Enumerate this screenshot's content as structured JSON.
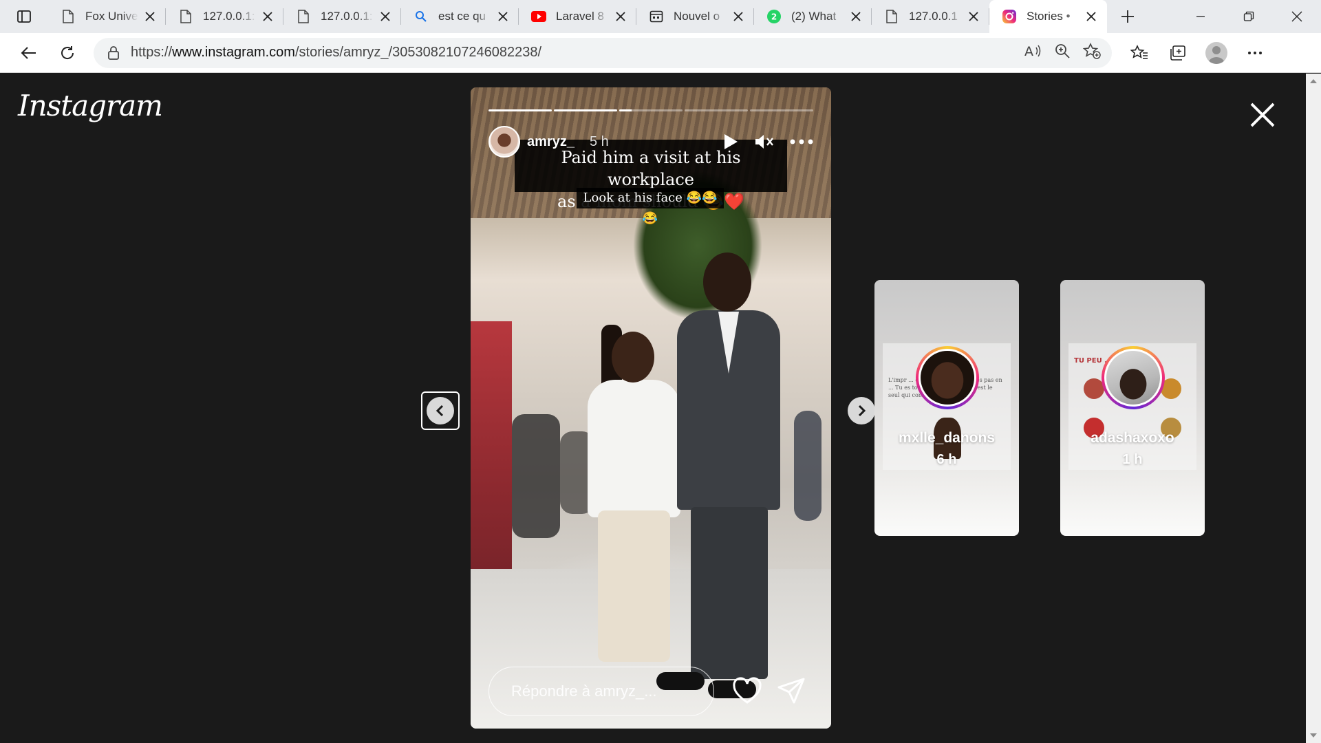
{
  "browser": {
    "tabs": [
      {
        "title": "Fox Unive",
        "icon": "document-icon"
      },
      {
        "title": "127.0.0.1:",
        "icon": "document-icon"
      },
      {
        "title": "127.0.0.1:",
        "icon": "document-icon"
      },
      {
        "title": "est ce qu",
        "icon": "search-icon"
      },
      {
        "title": "Laravel 8",
        "icon": "youtube-icon"
      },
      {
        "title": "Nouvel o",
        "icon": "calendar-icon"
      },
      {
        "title": "(2) What",
        "icon": "whatsapp-icon"
      },
      {
        "title": "127.0.0.1",
        "icon": "document-icon"
      },
      {
        "title": "Stories •",
        "icon": "instagram-icon",
        "active": true
      }
    ],
    "address": {
      "prefix": "https://",
      "host": "www.instagram.com",
      "path": "/stories/amryz_/3053082107246082238/"
    }
  },
  "page": {
    "logo": "Instagram",
    "story": {
      "username": "amryz_",
      "time": "5 h",
      "progress": [
        1.0,
        1.0,
        0.2,
        0.0,
        0.0
      ],
      "caption_line1": "Paid him a visit at his workplace",
      "caption_line2": "as a mom should 😂❤️",
      "caption_line3": "Look at his face 😂😂😂",
      "reply_placeholder": "Répondre à amryz_..."
    },
    "previews": [
      {
        "username": "mxlle_danons",
        "time": "6 h",
        "mini_text": "L'impr ... ctard par ... res. Tu n'es pas en ... Tu es ton propre chemin et c'est le seul qui compte."
      },
      {
        "username": "adashaxoxo",
        "time": "1 h",
        "mini_text": "TU PEU ... FOIS :"
      }
    ]
  },
  "colors": {
    "page_bg": "#1a1a1a",
    "tabstrip_bg": "#e9ebee",
    "caption_bg": "#000000",
    "ring_gradient": [
      "#f9ce34",
      "#ee2a7b",
      "#6228d7"
    ]
  }
}
